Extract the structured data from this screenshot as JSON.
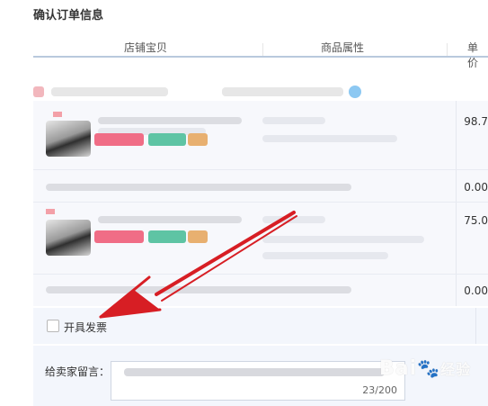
{
  "page_title": "确认订单信息",
  "table_header": {
    "col_shop_item": "店铺宝贝",
    "col_attributes": "商品属性",
    "col_unit_price": "单价"
  },
  "items": [
    {
      "price": "98.7"
    },
    {
      "price": "0.00"
    },
    {
      "price": "75.0"
    },
    {
      "price": "0.00"
    }
  ],
  "invoice": {
    "label": "开具发票"
  },
  "message": {
    "label": "给卖家留言：",
    "counter": "23/200"
  },
  "watermark": {
    "text": "Bai",
    "suffix": "经验"
  },
  "colors": {
    "annotation_arrow": "#d71e24",
    "header_rule": "#b9c9dd",
    "row_background": "#f3f6fc"
  }
}
